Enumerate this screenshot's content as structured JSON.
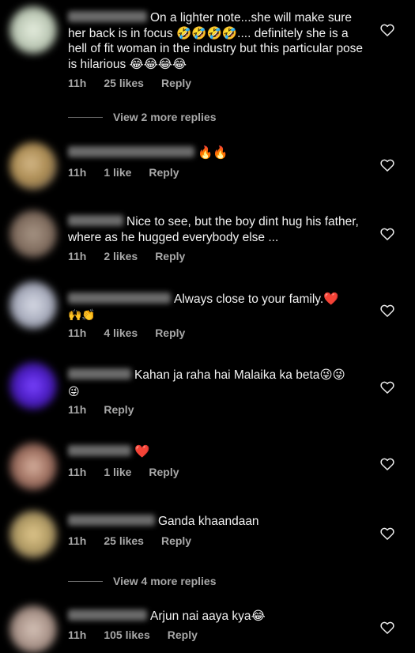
{
  "comments": [
    {
      "text": "On a lighter note...she will make sure her back is in focus 🤣🤣🤣🤣.... definitely she is a hell of fit woman in the industry but this particular pose is hilarious 😂😂😂😂",
      "time": "11h",
      "likes": "25 likes",
      "reply": "Reply",
      "view_replies": "View 2 more replies",
      "avatar_color": "#c8d6c0"
    },
    {
      "text": "🔥🔥",
      "time": "11h",
      "likes": "1 like",
      "reply": "Reply",
      "avatar_color": "#c9a774"
    },
    {
      "text": "Nice to see, but the boy dint hug his father, where as he hugged everybody else ...",
      "time": "11h",
      "likes": "2 likes",
      "reply": "Reply",
      "avatar_color": "#8a7868"
    },
    {
      "text": "Always close to your family.❤️",
      "second_line": "🙌👏",
      "time": "11h",
      "likes": "4 likes",
      "reply": "Reply",
      "avatar_color": "#b9bcc8"
    },
    {
      "text": "Kahan ja raha hai Malaika ka beta😜😜",
      "second_line": "😜",
      "time": "11h",
      "reply": "Reply",
      "avatar_color": "#5a2bd0"
    },
    {
      "text": "❤️",
      "time": "11h",
      "likes": "1 like",
      "reply": "Reply",
      "avatar_color": "#8b5a4a"
    },
    {
      "text": "Ganda khaandaan",
      "time": "11h",
      "likes": "25 likes",
      "reply": "Reply",
      "view_replies": "View 4 more replies",
      "avatar_color": "#c6b27a"
    },
    {
      "text": "Arjun nai aaya kya😂",
      "time": "11h",
      "likes": "105 likes",
      "reply": "Reply",
      "avatar_color": "#b7a297"
    }
  ]
}
